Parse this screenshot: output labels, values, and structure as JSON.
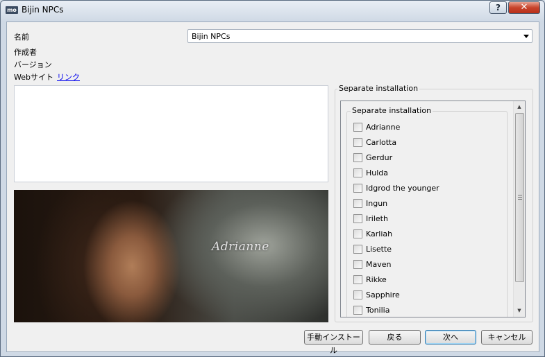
{
  "window": {
    "app_icon_text": "mo",
    "title": "Bijin NPCs",
    "help_label": "?",
    "close_label": "✕"
  },
  "form": {
    "name_label": "名前",
    "author_label": "作成者",
    "version_label": "バージョン",
    "website_label": "Webサイト",
    "website_link": "リンク",
    "name_value": "Bijin NPCs"
  },
  "screenshot": {
    "caption": "Adrianne"
  },
  "options_panel": {
    "group_title": "Separate installation",
    "inner_title": "Separate installation",
    "items": [
      {
        "label": "Adrianne",
        "checked": false
      },
      {
        "label": "Carlotta",
        "checked": false
      },
      {
        "label": "Gerdur",
        "checked": false
      },
      {
        "label": "Hulda",
        "checked": false
      },
      {
        "label": "Idgrod the younger",
        "checked": false
      },
      {
        "label": "Ingun",
        "checked": false
      },
      {
        "label": "Irileth",
        "checked": false
      },
      {
        "label": "Karliah",
        "checked": false
      },
      {
        "label": "Lisette",
        "checked": false
      },
      {
        "label": "Maven",
        "checked": false
      },
      {
        "label": "Rikke",
        "checked": false
      },
      {
        "label": "Sapphire",
        "checked": false
      },
      {
        "label": "Tonilia",
        "checked": false
      }
    ]
  },
  "buttons": {
    "manual_install": "手動インストール",
    "back": "戻る",
    "next": "次へ",
    "cancel": "キャンセル"
  }
}
